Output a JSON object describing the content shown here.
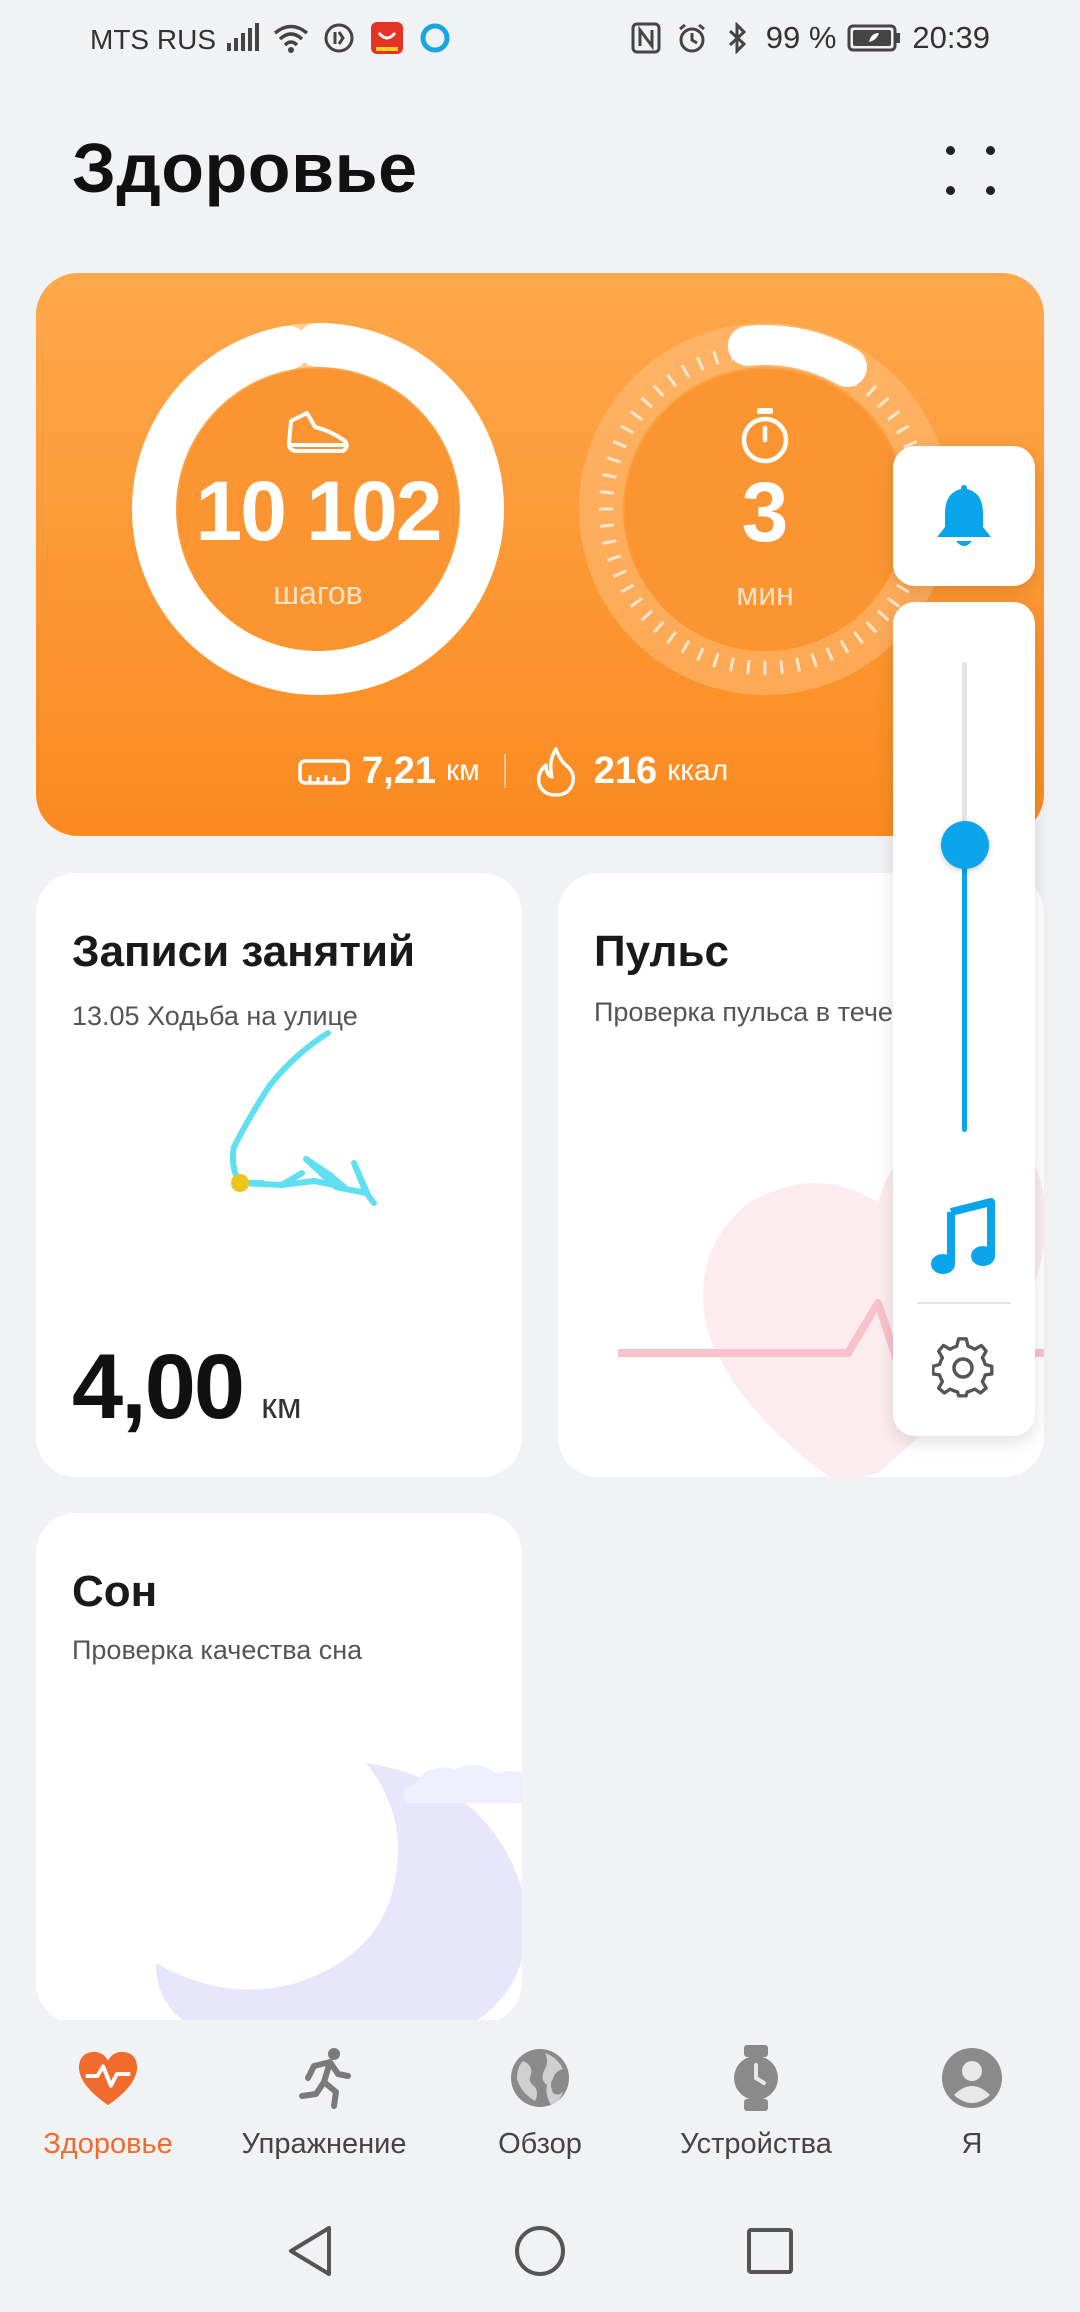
{
  "status_bar": {
    "carrier": "MTS RUS",
    "battery": "99 %",
    "time": "20:39",
    "icons_left": [
      "signal-icon",
      "wifi-icon",
      "data-saver-icon",
      "aliexpress-app-icon",
      "assistant-app-icon"
    ],
    "icons_right": [
      "nfc-icon",
      "alarm-icon",
      "bluetooth-icon",
      "battery-icon"
    ]
  },
  "header": {
    "title": "Здоровье"
  },
  "activity": {
    "steps_value": "10 102",
    "steps_unit": "шагов",
    "steps_progress": 0.97,
    "minutes_value": "3",
    "minutes_unit": "мин",
    "minutes_progress": 0.1,
    "distance_value": "7,21",
    "distance_unit": "км",
    "calories_value": "216",
    "calories_unit": "ккал"
  },
  "records": {
    "title": "Записи занятий",
    "subtitle": "13.05  Ходьба на улице",
    "distance_value": "4,00",
    "distance_unit": "км"
  },
  "pulse": {
    "title": "Пульс",
    "subtitle": "Проверка пульса в течени..."
  },
  "sleep": {
    "title": "Сон",
    "subtitle": "Проверка качества сна"
  },
  "volume": {
    "level": 0.61,
    "accent": "#0aa5ea"
  },
  "nav": {
    "items": [
      {
        "label": "Здоровье",
        "active": true
      },
      {
        "label": "Упражнение",
        "active": false
      },
      {
        "label": "Обзор",
        "active": false
      },
      {
        "label": "Устройства",
        "active": false
      },
      {
        "label": "Я",
        "active": false
      }
    ],
    "active_color": "#f26b2e"
  },
  "colors": {
    "card_orange_top": "#fea84c",
    "card_orange_bottom": "#fb8a1f",
    "background": "#f1f2f4"
  }
}
